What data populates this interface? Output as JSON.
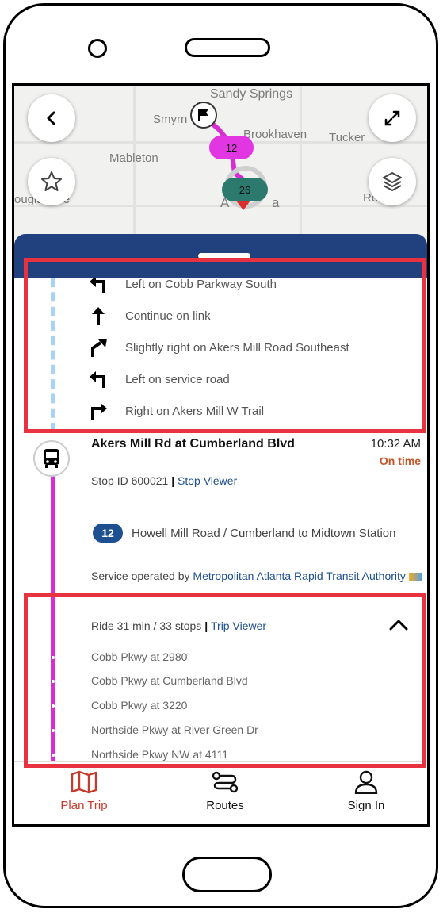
{
  "map": {
    "labels": {
      "sandy_springs": "Sandy Springs",
      "smyrna": "Smyrn",
      "brookhaven": "Brookhaven",
      "tucker": "Tucker",
      "mableton": "Mableton",
      "douglasville": "ouglasville",
      "atlanta_a": "A",
      "atlanta_end": "a",
      "decatur": "Re"
    },
    "badges": {
      "route_12": "12",
      "route_26": "26"
    },
    "buttons": {
      "back": "back-icon",
      "expand": "expand-icon",
      "favorite": "star-icon",
      "layers": "layers-icon"
    }
  },
  "steps": [
    {
      "icon": "turn-left-icon",
      "text": "Left on Cobb Parkway South"
    },
    {
      "icon": "straight-icon",
      "text": "Continue on link"
    },
    {
      "icon": "slight-right-icon",
      "text": "Slightly right on Akers Mill Road Southeast"
    },
    {
      "icon": "turn-left-icon",
      "text": "Left on service road"
    },
    {
      "icon": "turn-right-icon",
      "text": "Right on Akers Mill W Trail"
    }
  ],
  "stop": {
    "name": "Akers Mill Rd at Cumberland Blvd",
    "time": "10:32 AM",
    "status": "On time",
    "stop_id": "Stop ID 600021",
    "stop_viewer": "Stop Viewer"
  },
  "route": {
    "number": "12",
    "name": "Howell Mill Road / Cumberland to Midtown Station",
    "operated_prefix": "Service operated by",
    "operator": "Metropolitan Atlanta Rapid Transit Authority"
  },
  "ride": {
    "summary": "Ride 31 min / 33 stops",
    "trip_viewer": "Trip Viewer",
    "stops": [
      "Cobb Pkwy at 2980",
      "Cobb Pkwy at Cumberland Blvd",
      "Cobb Pkwy at 3220",
      "Northside Pkwy at River Green Dr",
      "Northside Pkwy NW at 4111"
    ]
  },
  "nav": {
    "plan_trip": "Plan Trip",
    "routes": "Routes",
    "sign_in": "Sign In"
  },
  "colors": {
    "header": "#21417e",
    "bus_line": "#d62ed2",
    "walk_line": "#a9d3f3",
    "highlight": "#e8323f",
    "active_tab": "#c6392b",
    "link": "#1d4f91"
  }
}
